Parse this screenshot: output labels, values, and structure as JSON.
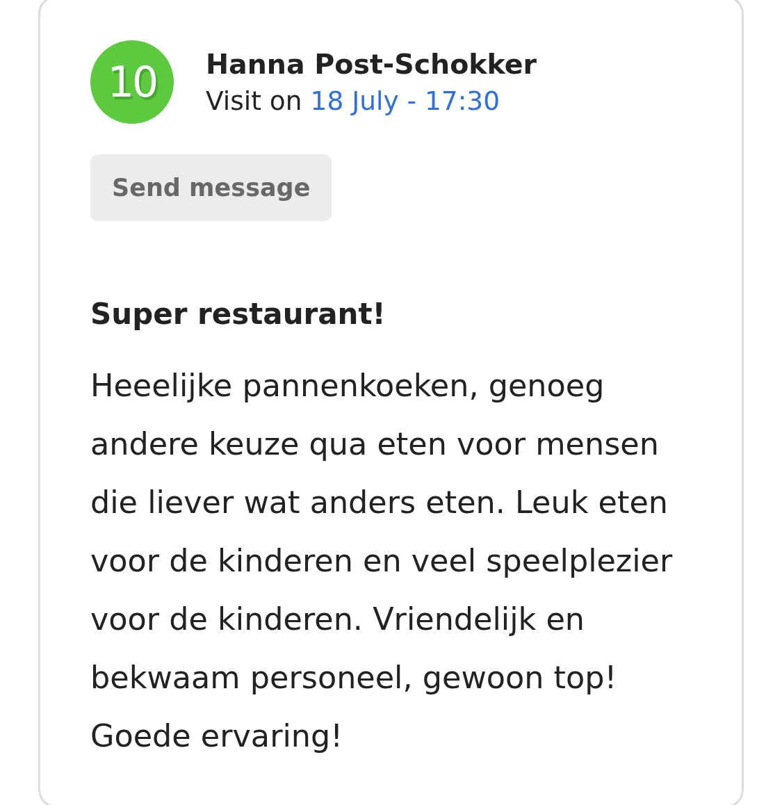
{
  "review": {
    "score": "10",
    "reviewer": "Hanna Post-Schokker",
    "visit_label": "Visit on",
    "visit_date": "18 July - 17:30",
    "send_button": "Send message",
    "title": "Super restaurant!",
    "body": "Heeelijke pannenkoeken, genoeg andere keuze qua eten voor mensen die liever wat anders eten. Leuk eten voor de kinderen en veel speelplezier voor de kinderen. Vriendelijk en bekwaam personeel, gewoon top! Goede ervaring!"
  }
}
